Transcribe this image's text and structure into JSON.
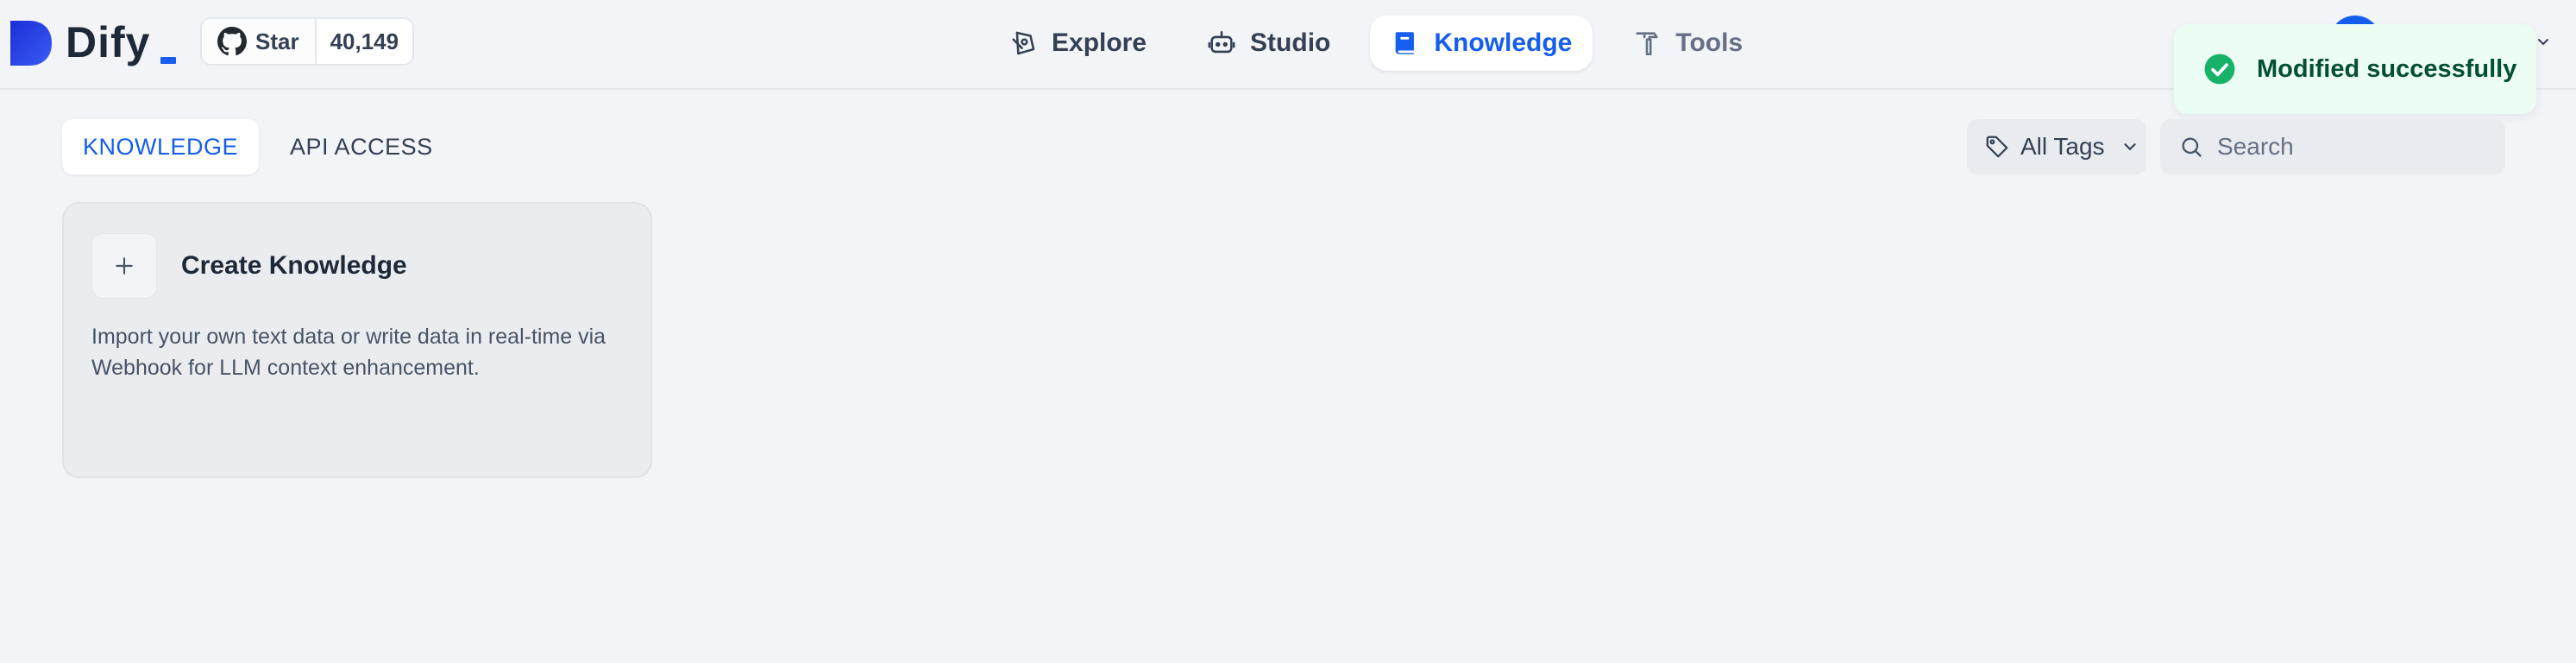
{
  "brand": {
    "name": "Dify"
  },
  "github": {
    "star_label": "Star",
    "star_count": "40,149"
  },
  "nav": {
    "items": [
      {
        "label": "Explore",
        "icon": "compass-icon"
      },
      {
        "label": "Studio",
        "icon": "robot-icon"
      },
      {
        "label": "Knowledge",
        "icon": "book-icon",
        "active": true
      },
      {
        "label": "Tools",
        "icon": "hammer-icon"
      }
    ]
  },
  "toast": {
    "message": "Modified successfully",
    "type": "success"
  },
  "tabs": [
    {
      "label": "KNOWLEDGE",
      "active": true
    },
    {
      "label": "API ACCESS",
      "active": false
    }
  ],
  "filters": {
    "tags_label": "All Tags",
    "search_placeholder": "Search"
  },
  "create_card": {
    "title": "Create Knowledge",
    "description": "Import your own text data or write data in real-time via Webhook for LLM context enhancement."
  },
  "colors": {
    "accent": "#155eef",
    "background": "#f2f4f7",
    "success_bg": "#ecfdf3",
    "success_icon": "#17b26a"
  }
}
